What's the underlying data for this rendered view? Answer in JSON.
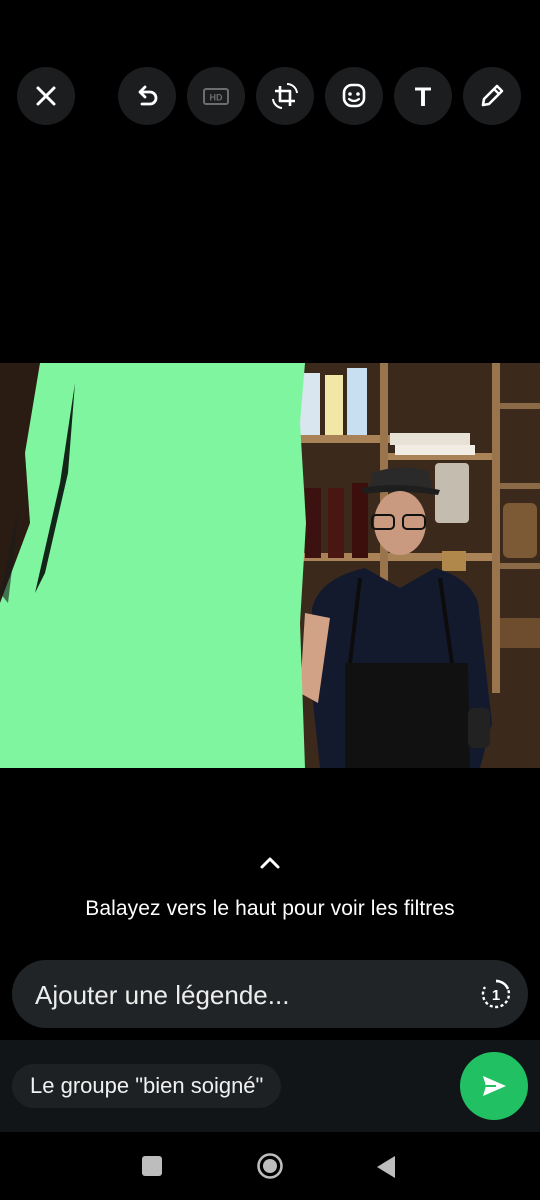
{
  "toolbar": {
    "icons": [
      "close-icon",
      "undo-icon",
      "hd-icon",
      "crop-rotate-icon",
      "sticker-icon",
      "text-icon",
      "pencil-icon"
    ],
    "hd_label": "HD",
    "text_tool_label": "T"
  },
  "photo": {
    "description_colors": {
      "paint": "#7ff59f",
      "background": "#000000"
    }
  },
  "filters": {
    "hint": "Balayez vers le haut pour voir les filtres"
  },
  "caption": {
    "placeholder": "Ajouter une légende...",
    "view_once_label": "1"
  },
  "recipient": {
    "label": "Le groupe \"bien soigné\""
  },
  "colors": {
    "accent": "#21c063",
    "button_bg": "#1b1d1f",
    "caption_bg": "#202426"
  }
}
